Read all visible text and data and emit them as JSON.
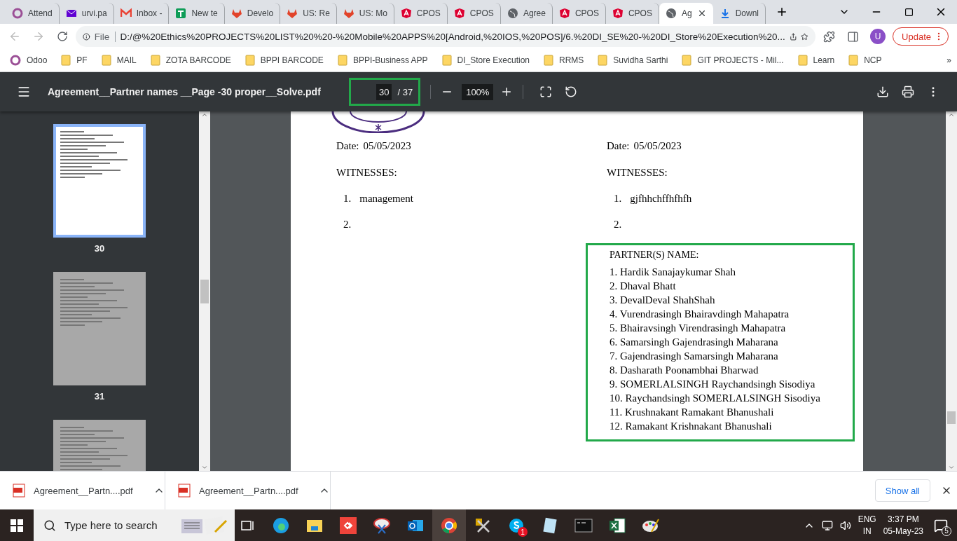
{
  "tabs": [
    {
      "title": "Attend",
      "kind": "ring",
      "selected": false
    },
    {
      "title": "urvi.pa",
      "kind": "mail",
      "selected": false
    },
    {
      "title": "Inbox -",
      "kind": "gmail",
      "selected": false
    },
    {
      "title": "New te",
      "kind": "sheet",
      "selected": false
    },
    {
      "title": "Develo",
      "kind": "fox",
      "selected": false
    },
    {
      "title": "US: Re",
      "kind": "fox",
      "selected": false
    },
    {
      "title": "US: Mo",
      "kind": "fox",
      "selected": false
    },
    {
      "title": "CPOS",
      "kind": "shield",
      "selected": false
    },
    {
      "title": "CPOS",
      "kind": "shield",
      "selected": false
    },
    {
      "title": "Agree",
      "kind": "globe",
      "selected": false
    },
    {
      "title": "CPOS",
      "kind": "shield",
      "selected": false
    },
    {
      "title": "CPOS",
      "kind": "shield",
      "selected": false
    },
    {
      "title": "Ag",
      "kind": "globe",
      "selected": true
    },
    {
      "title": "Downl",
      "kind": "download",
      "selected": false
    }
  ],
  "address": {
    "scheme": "File",
    "url": "D:/@%20Ethics%20PROJECTS%20LIST%20%20-%20Mobile%20APPS%20[Android,%20IOS,%20POS]/6.%20DI_SE%20-%20DI_Store%20Execution%20..."
  },
  "profile": {
    "initial": "U"
  },
  "update_button": "Update",
  "bookmarks": [
    {
      "label": "Odoo",
      "kind": "ring"
    },
    {
      "label": "PF",
      "kind": "folder"
    },
    {
      "label": "MAIL",
      "kind": "folder"
    },
    {
      "label": "ZOTA BARCODE",
      "kind": "folder"
    },
    {
      "label": "BPPI BARCODE",
      "kind": "folder"
    },
    {
      "label": "BPPI-Business APP",
      "kind": "folder"
    },
    {
      "label": "DI_Store Execution",
      "kind": "folder"
    },
    {
      "label": "RRMS",
      "kind": "folder"
    },
    {
      "label": "Suvidha Sarthi",
      "kind": "folder"
    },
    {
      "label": "GIT PROJECTS - Mil...",
      "kind": "folder"
    },
    {
      "label": "Learn",
      "kind": "folder"
    },
    {
      "label": "NCP",
      "kind": "folder"
    }
  ],
  "bookmarks_more": "»",
  "pdf_toolbar": {
    "title": "Agreement__Partner names __Page -30 proper__Solve.pdf",
    "page": "30",
    "page_total": "/ 37",
    "zoom": "100%"
  },
  "thumbnails": [
    {
      "label": "30",
      "selected": true
    },
    {
      "label": "31",
      "selected": false
    },
    {
      "selected": false
    }
  ],
  "document": {
    "columns": [
      {
        "date_label": "Date:",
        "date": "05/05/2023",
        "witnesses_heading": "WITNESSES:",
        "witnesses": [
          {
            "number": "1.",
            "name": "management"
          },
          {
            "number": "2."
          }
        ]
      },
      {
        "date_label": "Date:",
        "date": "05/05/2023",
        "witnesses_heading": "WITNESSES:",
        "witnesses": [
          {
            "number": "1.",
            "name": "gjfhhchffhfhfh"
          },
          {
            "number": "2."
          }
        ]
      }
    ],
    "partners_heading": "PARTNER(S) NAME:",
    "partners": [
      "1. Hardik Sanajaykumar Shah",
      "2. Dhaval Bhatt",
      "3. DevalDeval ShahShah",
      "4. Vurendrasingh Bhairavdingh Mahapatra",
      "5. Bhairavsingh Virendrasingh Mahapatra",
      "6. Samarsingh Gajendrasingh Maharana",
      "7. Gajendrasingh Samarsingh Maharana",
      "8. Dasharath Poonambhai Bharwad",
      "9. SOMERLALSINGH Raychandsingh Sisodiya",
      "10. Raychandsingh SOMERLALSINGH Sisodiya",
      "11. Krushnakant Ramakant Bhanushali",
      "12. Ramakant Krishnakant Bhanushali"
    ]
  },
  "downloads": [
    "Agreement__Partn....pdf",
    "Agreement__Partn....pdf"
  ],
  "show_all": "Show all",
  "taskbar": {
    "search_placeholder": "Type here to search",
    "apps": [
      {
        "kind": "news"
      },
      {
        "kind": "taskview"
      },
      {
        "kind": "edge"
      },
      {
        "kind": "folder"
      },
      {
        "kind": "remote"
      },
      {
        "kind": "snip"
      },
      {
        "kind": "outlook"
      },
      {
        "kind": "chrome",
        "selected": true
      },
      {
        "kind": "tools"
      },
      {
        "kind": "skype",
        "badge": "1"
      },
      {
        "kind": "notepad"
      },
      {
        "kind": "terminal"
      },
      {
        "kind": "excel"
      },
      {
        "kind": "paint"
      }
    ],
    "language": "ENG",
    "region": "IN",
    "time": "3:37 PM",
    "date": "05-May-23",
    "notifications": "5"
  }
}
